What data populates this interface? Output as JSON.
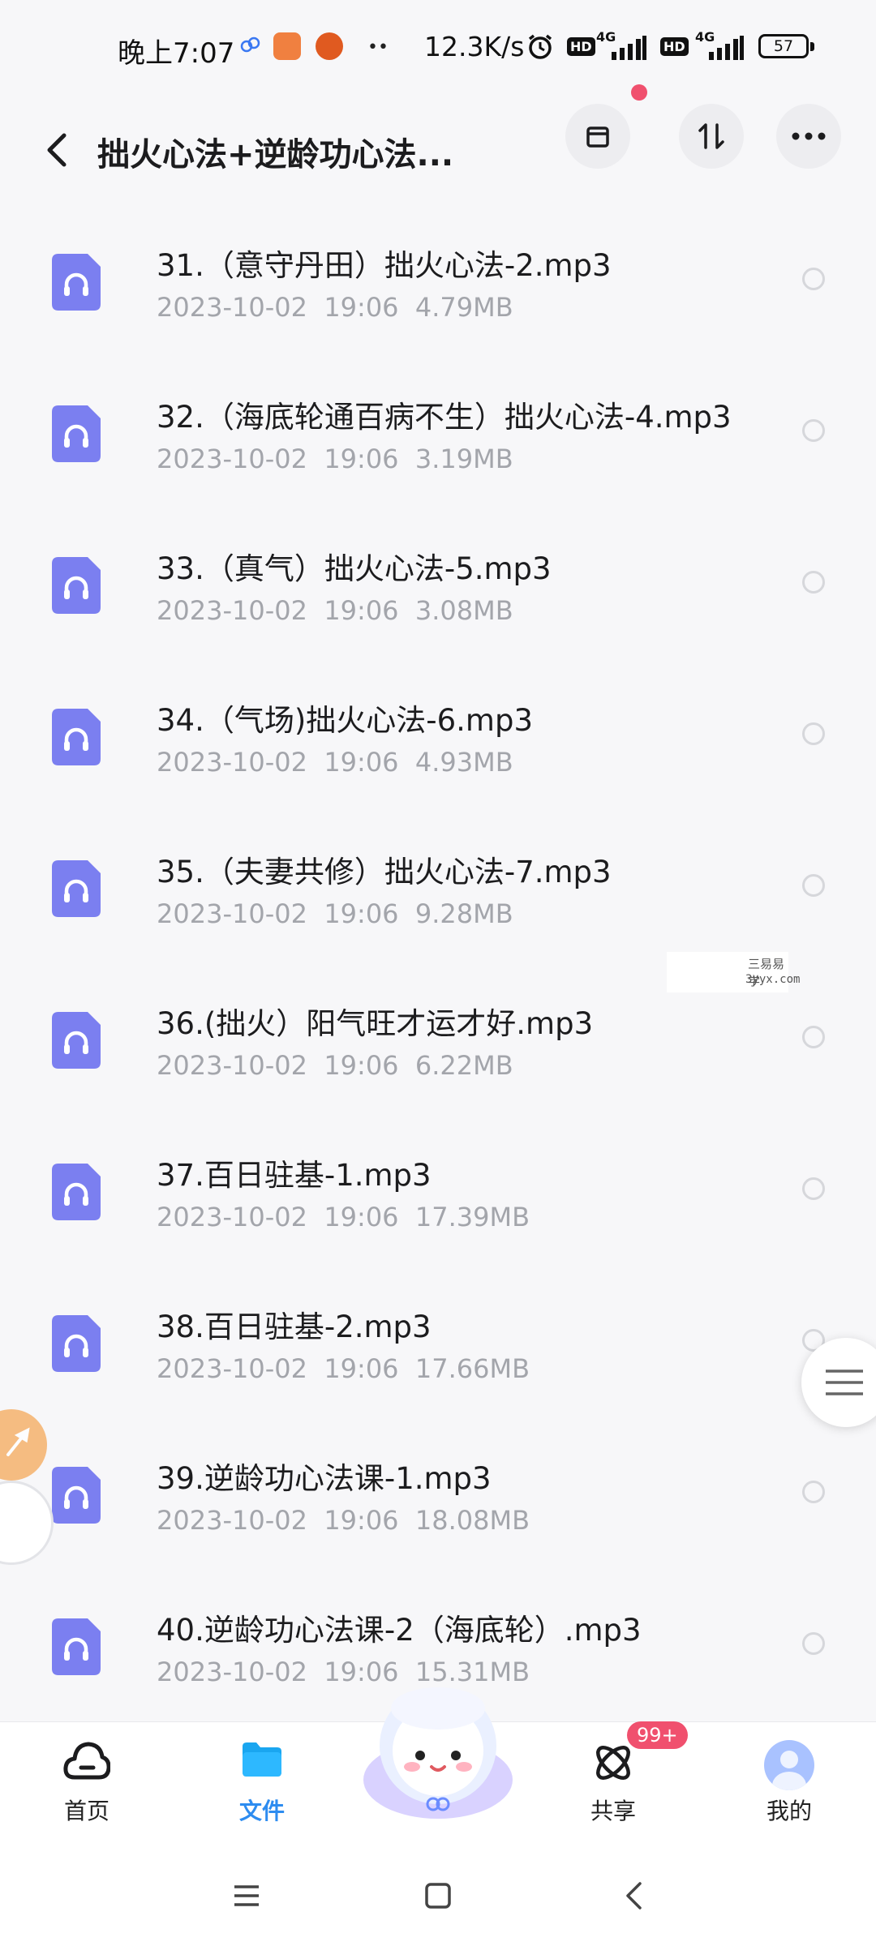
{
  "status_bar": {
    "time": "晚上7:07",
    "speed": "12.3K/s",
    "hd1": "HD",
    "net1": "4G",
    "hd2": "HD",
    "net2": "4G",
    "battery": "57"
  },
  "header": {
    "title": "拙火心法+逆龄功心法...",
    "archive_icon": "archive-icon",
    "sort_icon": "sort-icon",
    "more_icon": "more-icon"
  },
  "files": [
    {
      "name": "31.（意守丹田）拙火心法-2.mp3",
      "meta": "2023-10-02  19:06  4.79MB"
    },
    {
      "name": "32.（海底轮通百病不生）拙火心法-4.mp3",
      "meta": "2023-10-02  19:06  3.19MB"
    },
    {
      "name": "33.（真气）拙火心法-5.mp3",
      "meta": "2023-10-02  19:06  3.08MB"
    },
    {
      "name": "34.（气场)拙火心法-6.mp3",
      "meta": "2023-10-02  19:06  4.93MB"
    },
    {
      "name": "35.（夫妻共修）拙火心法-7.mp3",
      "meta": "2023-10-02  19:06  9.28MB"
    },
    {
      "name": "36.(拙火）阳气旺才运才好.mp3",
      "meta": "2023-10-02  19:06  6.22MB"
    },
    {
      "name": "37.百日驻基-1.mp3",
      "meta": "2023-10-02  19:06  17.39MB"
    },
    {
      "name": "38.百日驻基-2.mp3",
      "meta": "2023-10-02  19:06  17.66MB"
    },
    {
      "name": "39.逆龄功心法课-1.mp3",
      "meta": "2023-10-02  19:06  18.08MB"
    },
    {
      "name": "40.逆龄功心法课-2（海底轮）.mp3",
      "meta": "2023-10-02  19:06  15.31MB"
    }
  ],
  "watermark": {
    "cn": "三易易学",
    "url": "3yyx.com"
  },
  "bottom_nav": {
    "home": "首页",
    "files": "文件",
    "share": "共享",
    "share_badge": "99+",
    "mine": "我的"
  },
  "colors": {
    "accent": "#2d8cf0",
    "file_icon": "#7b7ff0",
    "badge": "#f0506e"
  }
}
